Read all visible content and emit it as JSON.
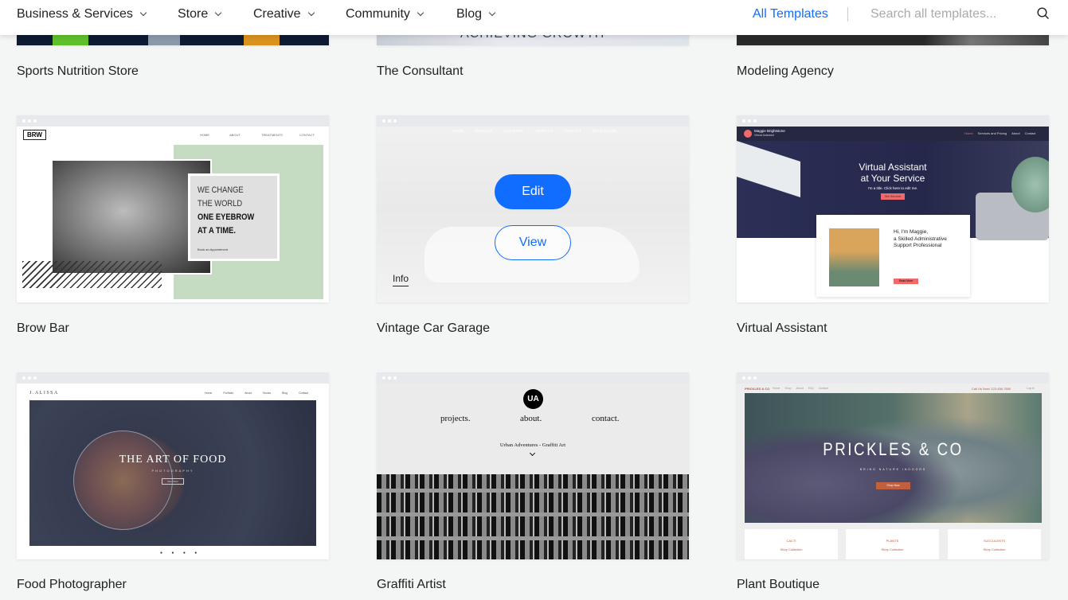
{
  "header": {
    "nav": [
      {
        "label": "Business & Services"
      },
      {
        "label": "Store"
      },
      {
        "label": "Creative"
      },
      {
        "label": "Community"
      },
      {
        "label": "Blog"
      }
    ],
    "all_templates": "All Templates",
    "search_placeholder": "Search all templates...",
    "accent": "#116dff"
  },
  "templates": [
    {
      "name": "Sports Nutrition Store"
    },
    {
      "name": "The Consultant",
      "thumb_text": "ACHIEVING GROWTH"
    },
    {
      "name": "Modeling Agency"
    },
    {
      "name": "Brow Bar",
      "thumb": {
        "logo": "BRW",
        "nav": [
          "HOME",
          "ABOUT",
          "TREATMENTS",
          "CONTACT"
        ],
        "headline": [
          "WE CHANGE",
          "THE WORLD",
          "ONE EYEBROW",
          "AT A TIME."
        ],
        "cta": "Book an Appointment"
      }
    },
    {
      "name": "Vintage Car Garage",
      "hover": {
        "edit": "Edit",
        "view": "View",
        "info": "Info"
      },
      "thumb": {
        "nav": [
          "HOME",
          "SERVICES",
          "OUR WORK",
          "ABOUT US",
          "CONTACT",
          "BOOK ONLINE"
        ]
      }
    },
    {
      "name": "Virtual Assistant",
      "thumb": {
        "brand": "Maggie Brightstone",
        "subtitle": "Virtual Assistant",
        "nav": [
          "Home",
          "Services and Pricing",
          "About",
          "Contact"
        ],
        "headline": [
          "Virtual Assistant",
          "at Your Service"
        ],
        "tagline": "I'm a title. Click here to edit me.",
        "button": "See Services",
        "card_title": [
          "Hi, I'm Maggie,",
          "a Skilled Administrative",
          "Support Professional"
        ],
        "card_button": "Read More"
      }
    },
    {
      "name": "Food Photographer",
      "thumb": {
        "brand": "J.ALISSA",
        "nav": [
          "Home",
          "Portfolio",
          "About",
          "Books",
          "Blog",
          "Contact"
        ],
        "headline": "THE ART OF FOOD",
        "sub": "PHOTOGRAPHY",
        "button": "View More"
      }
    },
    {
      "name": "Graffiti Artist",
      "thumb": {
        "logo": "UA",
        "nav": [
          "projects.",
          "about.",
          "contact."
        ],
        "subtitle": "Urban Adventures - Graffiti Art"
      }
    },
    {
      "name": "Plant Boutique",
      "thumb": {
        "brand": "PRICKLES & CO",
        "nav": [
          "Home",
          "Shop",
          "About",
          "FAQ",
          "Contact"
        ],
        "phone": "Call Us Now! 123-456-7890",
        "login": "Log In",
        "headline": "PRICKLES & CO",
        "tagline": "BRING NATURE INDOORS",
        "button": "Shop Now",
        "collections": [
          "CACTI",
          "PLANTS",
          "SUCCULENTS"
        ],
        "collection_link": "Shop Collection"
      }
    }
  ]
}
